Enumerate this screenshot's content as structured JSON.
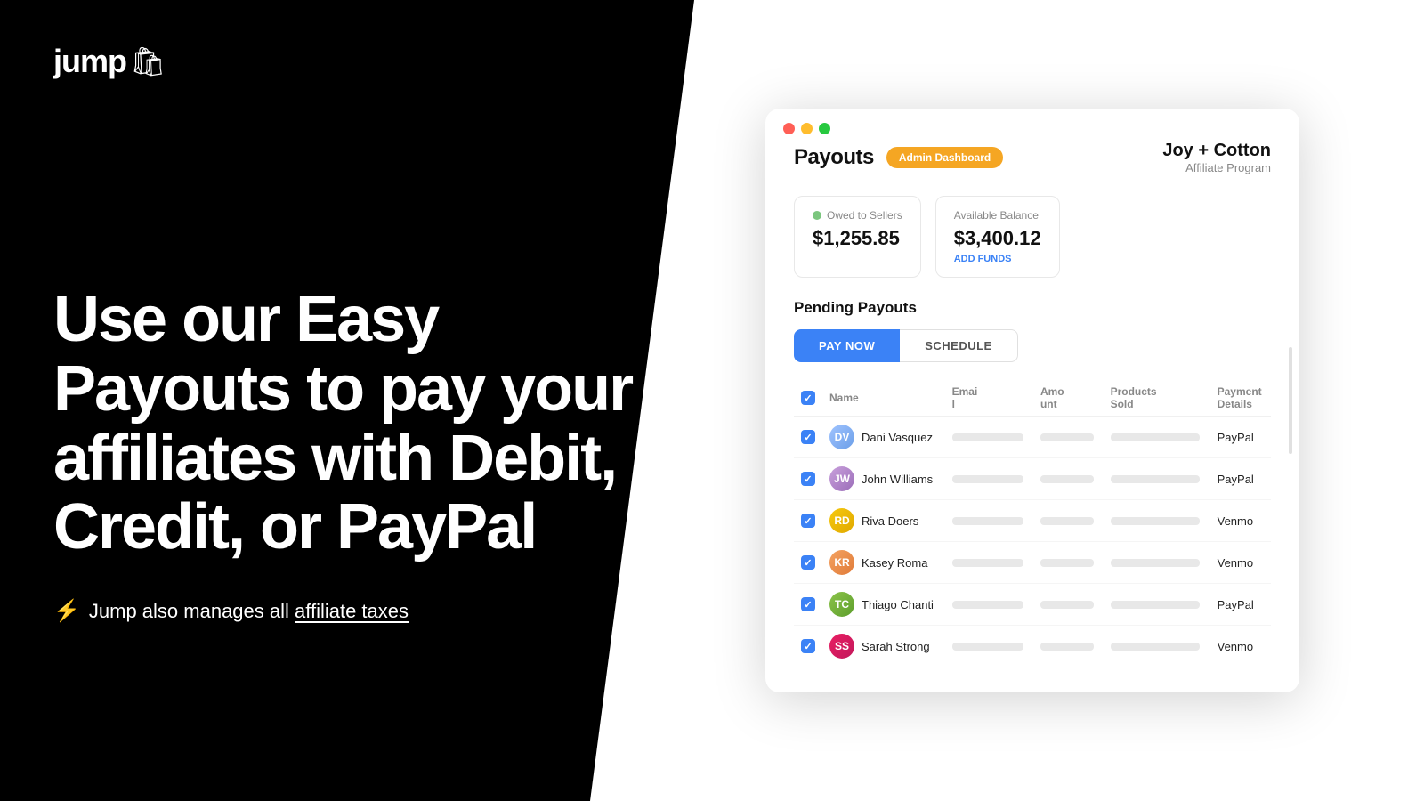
{
  "left": {
    "logo": {
      "text": "jump",
      "icon": "🛍"
    },
    "heading": "Use our Easy Payouts to  pay your affiliates with Debit, Credit, or PayPal",
    "tax_note_prefix": "⚡",
    "tax_note_text": "Jump also manages all ",
    "tax_note_link": "affiliate taxes"
  },
  "dashboard": {
    "page_title": "Payouts",
    "admin_badge": "Admin Dashboard",
    "brand_name": "Joy + Cotton",
    "brand_sub": "Affiliate Program",
    "stats": {
      "owed": {
        "label": "Owed to Sellers",
        "value": "$1,255.85"
      },
      "balance": {
        "label": "Available Balance",
        "value": "$3,400.12",
        "add_funds": "ADD FUNDS"
      }
    },
    "pending_title": "Pending Payouts",
    "buttons": {
      "pay_now": "PAY NOW",
      "schedule": "SCHEDULE"
    },
    "table": {
      "headers": [
        "",
        "Name",
        "Email",
        "Amount",
        "Products Sold",
        "Payment Details"
      ],
      "rows": [
        {
          "name": "Dani Vasquez",
          "initials": "DV",
          "avatar_class": "avatar-dv",
          "payment": "PayPal"
        },
        {
          "name": "John Williams",
          "initials": "JW",
          "avatar_class": "avatar-jw",
          "payment": "PayPal"
        },
        {
          "name": "Riva Doers",
          "initials": "RD",
          "avatar_class": "avatar-rd",
          "payment": "Venmo"
        },
        {
          "name": "Kasey Roma",
          "initials": "KR",
          "avatar_class": "avatar-kr",
          "payment": "Venmo"
        },
        {
          "name": "Thiago Chanti",
          "initials": "TC",
          "avatar_class": "avatar-tc",
          "payment": "PayPal"
        },
        {
          "name": "Sarah Strong",
          "initials": "SS",
          "avatar_class": "avatar-ss",
          "payment": "Venmo"
        }
      ]
    }
  }
}
